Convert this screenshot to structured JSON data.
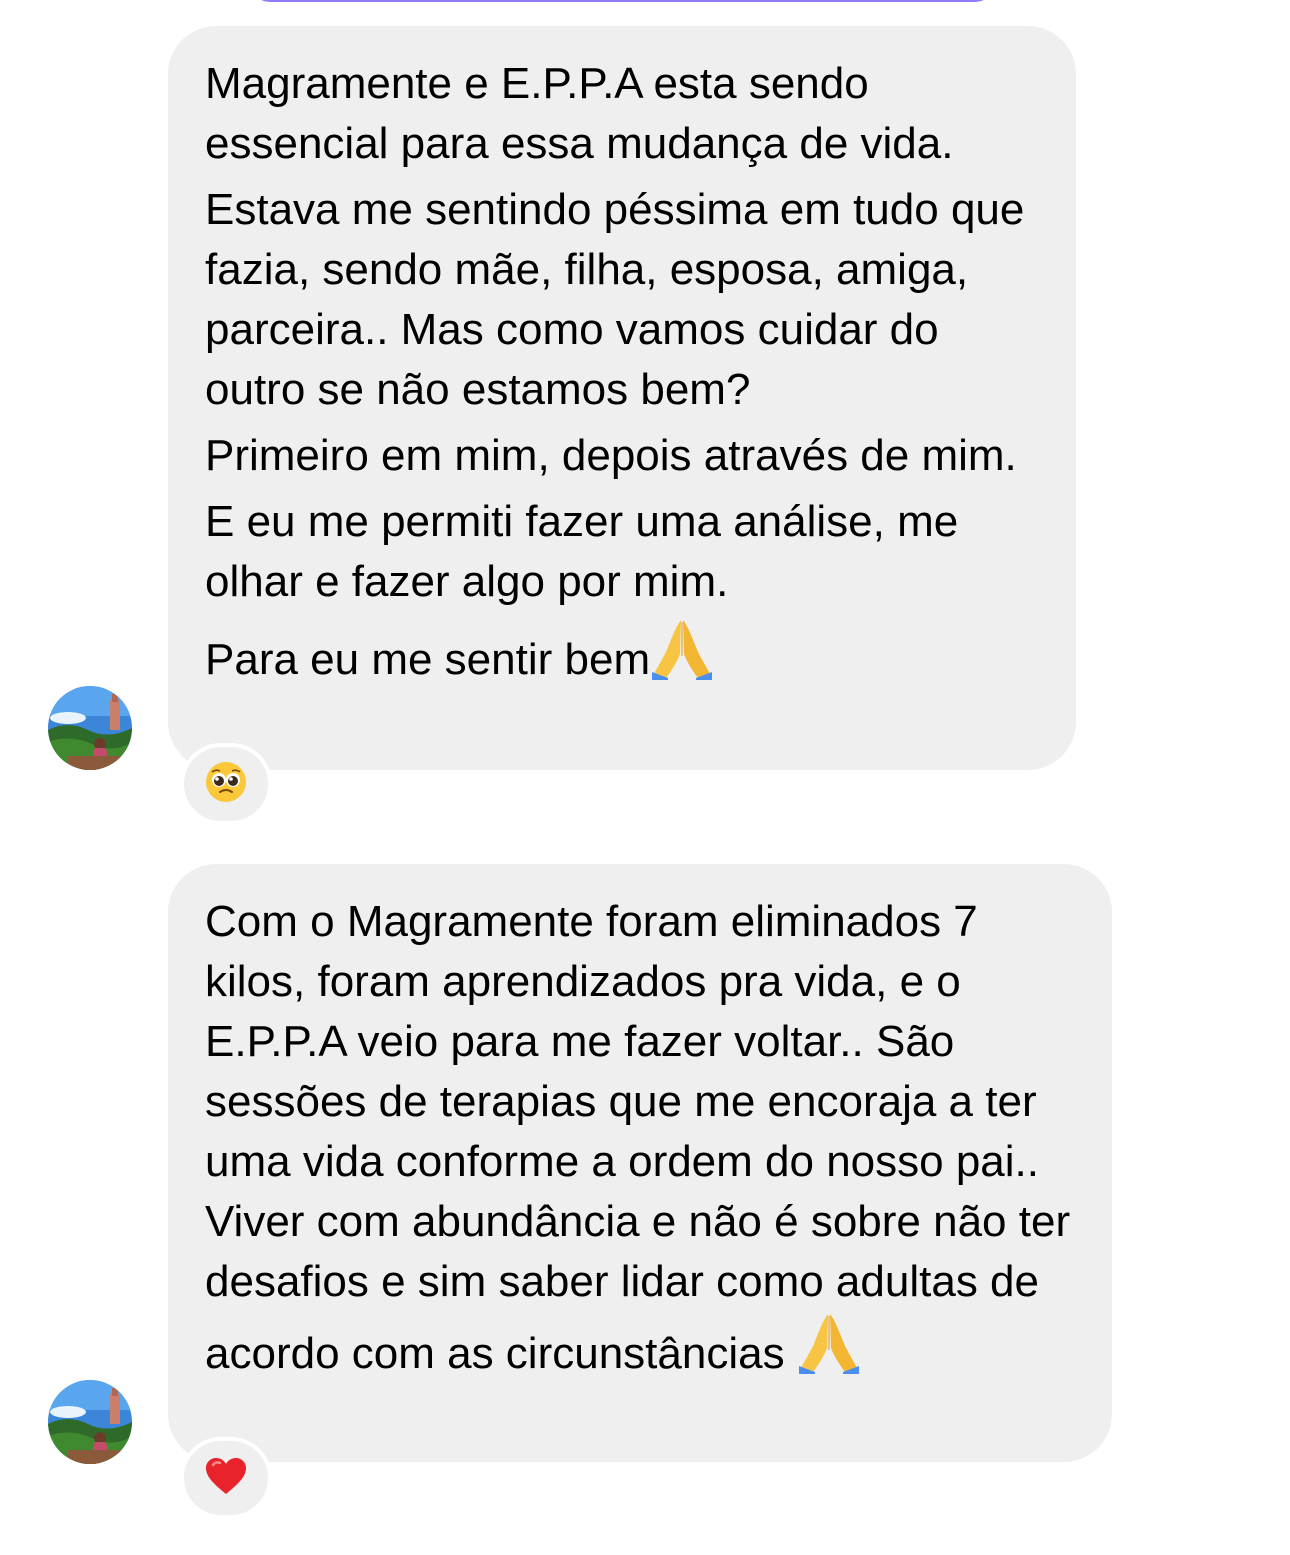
{
  "messages": [
    {
      "paragraphs": [
        "Magramente e E.P.P.A esta sendo essencial para essa mudança de vida.",
        "Estava me sentindo péssima em tudo que fazia, sendo mãe, filha, esposa, amiga, parceira.. Mas como vamos cuidar do outro se não estamos bem?",
        "Primeiro em mim, depois através de mim.",
        "E eu me permiti fazer uma análise, me olhar e fazer algo por mim."
      ],
      "last_line": "Para eu me sentir bem",
      "trailing_emoji": "folded-hands-icon",
      "reaction": "pleading-face-icon"
    },
    {
      "paragraphs": [],
      "last_line": "Com o Magramente foram eliminados 7 kilos, foram aprendizados pra vida, e o E.P.P.A veio para me fazer voltar.. São sessões de terapias que me encoraja a ter uma vida conforme a ordem do nosso pai.. Viver com abundância e não é sobre não ter desafios e sim saber lidar como adultas de acordo com as circunstâncias ",
      "trailing_emoji": "folded-hands-icon",
      "reaction": "red-heart-icon"
    }
  ],
  "colors": {
    "bubble_background": "#efefef",
    "accent_top_bar": "#8f7cf7",
    "text": "#000000"
  }
}
